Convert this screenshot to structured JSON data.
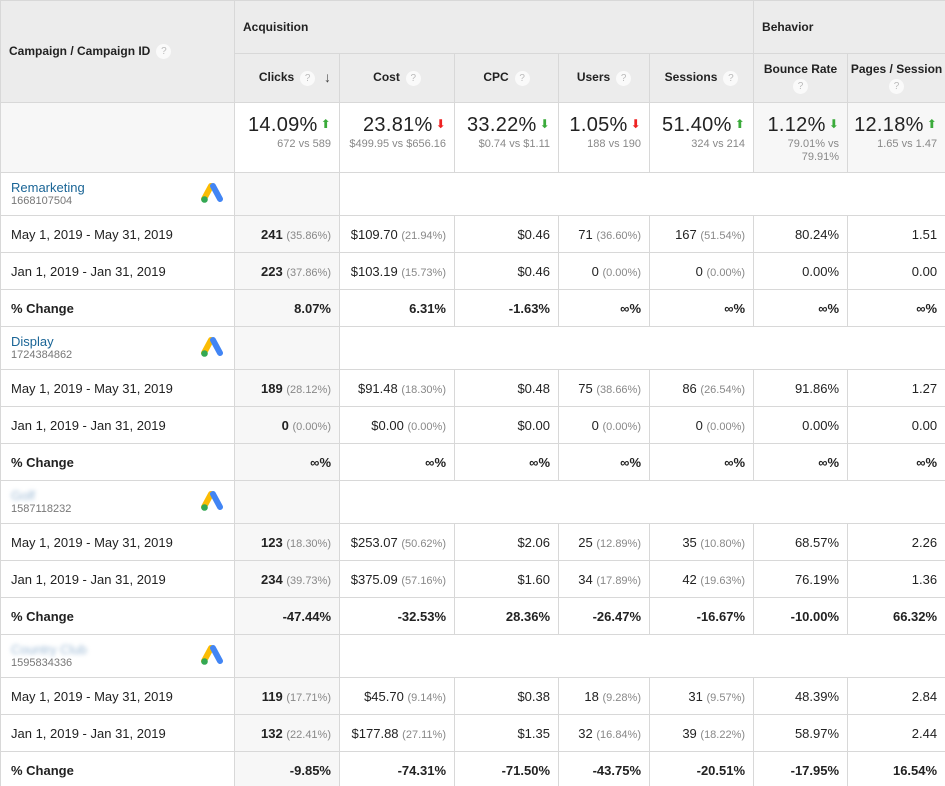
{
  "header": {
    "campaign_col": "Campaign / Campaign ID",
    "groups": [
      {
        "label": "Acquisition"
      },
      {
        "label": "Behavior"
      }
    ],
    "metrics": [
      {
        "label": "Clicks",
        "sorted": "descending"
      },
      {
        "label": "Cost"
      },
      {
        "label": "CPC"
      },
      {
        "label": "Users"
      },
      {
        "label": "Sessions"
      },
      {
        "label": "Bounce Rate"
      },
      {
        "label": "Pages / Session"
      }
    ],
    "help_glyph": "?",
    "sort_glyph": "↓"
  },
  "summary": [
    {
      "value": "14.09%",
      "trend": "up-green",
      "vs": "672 vs 589"
    },
    {
      "value": "23.81%",
      "trend": "down-red",
      "vs": "$499.95 vs $656.16"
    },
    {
      "value": "33.22%",
      "trend": "down-green",
      "vs": "$0.74 vs $1.11"
    },
    {
      "value": "1.05%",
      "trend": "down-red",
      "vs": "188 vs 190"
    },
    {
      "value": "51.40%",
      "trend": "up-green",
      "vs": "324 vs 214"
    },
    {
      "value": "1.12%",
      "trend": "down-green",
      "vs": "79.01% vs 79.91%"
    },
    {
      "value": "12.18%",
      "trend": "up-green",
      "vs": "1.65 vs 1.47"
    }
  ],
  "arrow_glyphs": {
    "up": "⬆",
    "down": "⬇"
  },
  "colors": {
    "up_green": "#3bab3b",
    "down_red": "#ee2222",
    "link_blue": "#1a6596"
  },
  "campaigns": [
    {
      "name": "Remarketing",
      "id": "1668107504",
      "blurred": false,
      "icon": "google-ads-logo",
      "rows": [
        {
          "label": "May 1, 2019 - May 31, 2019",
          "cells": [
            {
              "v": "241",
              "p": "(35.86%)"
            },
            {
              "v": "$109.70",
              "p": "(21.94%)"
            },
            {
              "v": "$0.46"
            },
            {
              "v": "71",
              "p": "(36.60%)"
            },
            {
              "v": "167",
              "p": "(51.54%)"
            },
            {
              "v": "80.24%"
            },
            {
              "v": "1.51"
            }
          ]
        },
        {
          "label": "Jan 1, 2019 - Jan 31, 2019",
          "cells": [
            {
              "v": "223",
              "p": "(37.86%)"
            },
            {
              "v": "$103.19",
              "p": "(15.73%)"
            },
            {
              "v": "$0.46"
            },
            {
              "v": "0",
              "p": "(0.00%)"
            },
            {
              "v": "0",
              "p": "(0.00%)"
            },
            {
              "v": "0.00%"
            },
            {
              "v": "0.00"
            }
          ]
        },
        {
          "label": "% Change",
          "change": true,
          "cells": [
            {
              "v": "8.07%"
            },
            {
              "v": "6.31%"
            },
            {
              "v": "-1.63%"
            },
            {
              "v": "∞%"
            },
            {
              "v": "∞%"
            },
            {
              "v": "∞%"
            },
            {
              "v": "∞%"
            }
          ]
        }
      ]
    },
    {
      "name": "Display",
      "id": "1724384862",
      "blurred": false,
      "icon": "google-ads-logo",
      "rows": [
        {
          "label": "May 1, 2019 - May 31, 2019",
          "cells": [
            {
              "v": "189",
              "p": "(28.12%)"
            },
            {
              "v": "$91.48",
              "p": "(18.30%)"
            },
            {
              "v": "$0.48"
            },
            {
              "v": "75",
              "p": "(38.66%)"
            },
            {
              "v": "86",
              "p": "(26.54%)"
            },
            {
              "v": "91.86%"
            },
            {
              "v": "1.27"
            }
          ]
        },
        {
          "label": "Jan 1, 2019 - Jan 31, 2019",
          "cells": [
            {
              "v": "0",
              "p": "(0.00%)"
            },
            {
              "v": "$0.00",
              "p": "(0.00%)"
            },
            {
              "v": "$0.00"
            },
            {
              "v": "0",
              "p": "(0.00%)"
            },
            {
              "v": "0",
              "p": "(0.00%)"
            },
            {
              "v": "0.00%"
            },
            {
              "v": "0.00"
            }
          ]
        },
        {
          "label": "% Change",
          "change": true,
          "cells": [
            {
              "v": "∞%"
            },
            {
              "v": "∞%"
            },
            {
              "v": "∞%"
            },
            {
              "v": "∞%"
            },
            {
              "v": "∞%"
            },
            {
              "v": "∞%"
            },
            {
              "v": "∞%"
            }
          ]
        }
      ]
    },
    {
      "name": "Golf",
      "id": "1587118232",
      "blurred": true,
      "icon": "google-ads-logo",
      "rows": [
        {
          "label": "May 1, 2019 - May 31, 2019",
          "cells": [
            {
              "v": "123",
              "p": "(18.30%)"
            },
            {
              "v": "$253.07",
              "p": "(50.62%)"
            },
            {
              "v": "$2.06"
            },
            {
              "v": "25",
              "p": "(12.89%)"
            },
            {
              "v": "35",
              "p": "(10.80%)"
            },
            {
              "v": "68.57%"
            },
            {
              "v": "2.26"
            }
          ]
        },
        {
          "label": "Jan 1, 2019 - Jan 31, 2019",
          "cells": [
            {
              "v": "234",
              "p": "(39.73%)"
            },
            {
              "v": "$375.09",
              "p": "(57.16%)"
            },
            {
              "v": "$1.60"
            },
            {
              "v": "34",
              "p": "(17.89%)"
            },
            {
              "v": "42",
              "p": "(19.63%)"
            },
            {
              "v": "76.19%"
            },
            {
              "v": "1.36"
            }
          ]
        },
        {
          "label": "% Change",
          "change": true,
          "cells": [
            {
              "v": "-47.44%"
            },
            {
              "v": "-32.53%"
            },
            {
              "v": "28.36%"
            },
            {
              "v": "-26.47%"
            },
            {
              "v": "-16.67%"
            },
            {
              "v": "-10.00%"
            },
            {
              "v": "66.32%"
            }
          ]
        }
      ]
    },
    {
      "name": "Country Club",
      "id": "1595834336",
      "blurred": true,
      "icon": "google-ads-logo",
      "rows": [
        {
          "label": "May 1, 2019 - May 31, 2019",
          "cells": [
            {
              "v": "119",
              "p": "(17.71%)"
            },
            {
              "v": "$45.70",
              "p": "(9.14%)"
            },
            {
              "v": "$0.38"
            },
            {
              "v": "18",
              "p": "(9.28%)"
            },
            {
              "v": "31",
              "p": "(9.57%)"
            },
            {
              "v": "48.39%"
            },
            {
              "v": "2.84"
            }
          ]
        },
        {
          "label": "Jan 1, 2019 - Jan 31, 2019",
          "cells": [
            {
              "v": "132",
              "p": "(22.41%)"
            },
            {
              "v": "$177.88",
              "p": "(27.11%)"
            },
            {
              "v": "$1.35"
            },
            {
              "v": "32",
              "p": "(16.84%)"
            },
            {
              "v": "39",
              "p": "(18.22%)"
            },
            {
              "v": "58.97%"
            },
            {
              "v": "2.44"
            }
          ]
        },
        {
          "label": "% Change",
          "change": true,
          "cells": [
            {
              "v": "-9.85%"
            },
            {
              "v": "-74.31%"
            },
            {
              "v": "-71.50%"
            },
            {
              "v": "-43.75%"
            },
            {
              "v": "-20.51%"
            },
            {
              "v": "-17.95%"
            },
            {
              "v": "16.54%"
            }
          ]
        }
      ]
    }
  ]
}
